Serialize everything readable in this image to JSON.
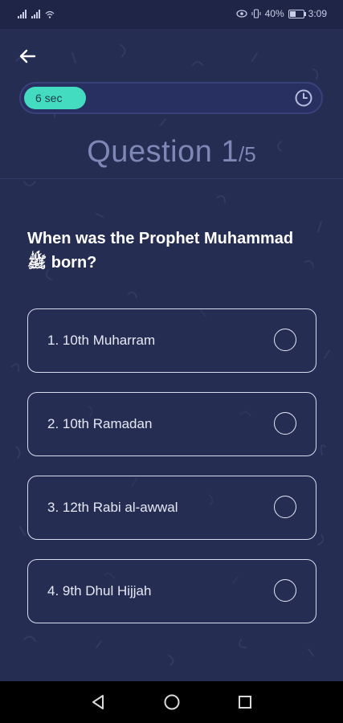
{
  "status_bar": {
    "battery": "40%",
    "time": "3:09",
    "signal_1": "4G",
    "signal_2": "4G"
  },
  "timer": {
    "label": "6 sec",
    "remaining_fraction": 0.21,
    "icon": "clock-icon"
  },
  "question_header": {
    "prefix": "Question 1",
    "total": "/5"
  },
  "question": {
    "text": "When was the Prophet Muhammad ﷺ born?"
  },
  "options": [
    {
      "label": "1. 10th Muharram"
    },
    {
      "label": "2. 10th Ramadan"
    },
    {
      "label": "3. 12th Rabi al-awwal"
    },
    {
      "label": "4. 9th Dhul Hijjah"
    }
  ],
  "colors": {
    "background": "#262d52",
    "timer_fill": "#43dcc0",
    "header_text": "#7f87b7",
    "option_border": "#d7dbef"
  },
  "nav": {
    "back": "back-triangle-icon",
    "home": "home-circle-icon",
    "recents": "recents-square-icon"
  }
}
